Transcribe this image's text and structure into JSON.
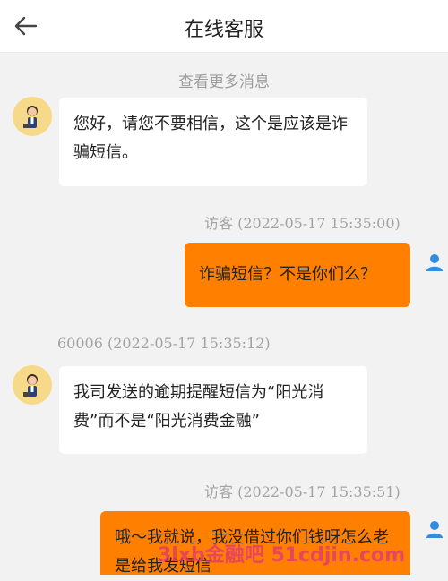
{
  "header": {
    "title": "在线客服"
  },
  "history": {
    "label": "查看更多消息"
  },
  "messages": [
    {
      "text": "您好，请您不要相信，这个是应该是诈骗短信。"
    },
    {
      "meta": "访客 (2022-05-17 15:35:00)",
      "text": "诈骗短信？不是你们么？"
    },
    {
      "meta": "60006 (2022-05-17 15:35:12)",
      "text": "我司发送的逾期提醒短信为“阳光消费”而不是“阳光消费金融”"
    },
    {
      "meta": "访客 (2022-05-17 15:35:51)",
      "text": "哦～我就说，我没借过你们钱呀怎么老是给我发短信"
    }
  ],
  "watermark": "3lxb金融吧 51cdjin.com",
  "colors": {
    "agent_bubble": "#ffffff",
    "visitor_bubble": "#ff7f00",
    "background": "#f2f2f2"
  }
}
